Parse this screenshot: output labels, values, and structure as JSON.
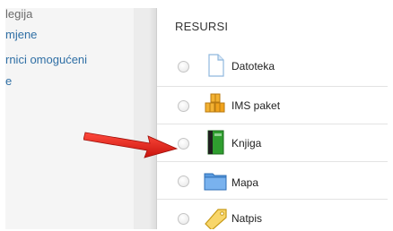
{
  "left_nav": {
    "items": [
      {
        "label": "legija"
      },
      {
        "label": "mjene"
      },
      {
        "label": "rnici omogućeni"
      },
      {
        "label": "e"
      }
    ]
  },
  "panel": {
    "title": "RESURSI",
    "items": [
      {
        "label": "Datoteka",
        "icon": "file-icon"
      },
      {
        "label": "IMS paket",
        "icon": "ims-package-icon"
      },
      {
        "label": "Knjiga",
        "icon": "book-icon"
      },
      {
        "label": "Mapa",
        "icon": "folder-icon"
      },
      {
        "label": "Natpis",
        "icon": "label-tag-icon"
      }
    ]
  },
  "colors": {
    "link": "#2f6fa5",
    "arrow": "#e8231b",
    "book": "#2f9e2f"
  }
}
